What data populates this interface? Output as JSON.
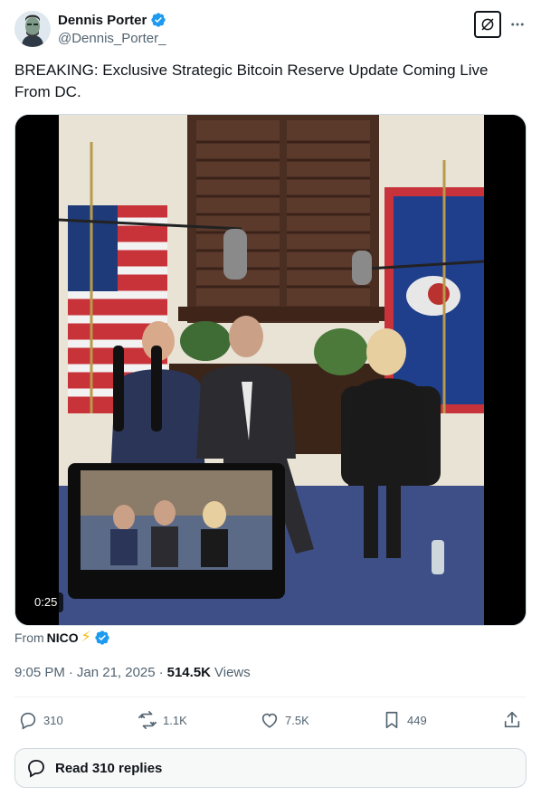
{
  "author": {
    "display_name": "Dennis Porter",
    "handle": "@Dennis_Porter_",
    "verified": true
  },
  "tweet": {
    "text": "BREAKING: Exclusive Strategic Bitcoin Reserve Update Coming Live From DC."
  },
  "media": {
    "duration": "0:25"
  },
  "source": {
    "label": "From",
    "name": "NICO",
    "emoji": "⚡"
  },
  "meta": {
    "time": "9:05 PM",
    "separator1": "·",
    "date": "Jan 21, 2025",
    "separator2": "·",
    "views_count": "514.5K",
    "views_label": "Views"
  },
  "actions": {
    "replies": "310",
    "reposts": "1.1K",
    "likes": "7.5K",
    "bookmarks": "449"
  },
  "read_replies": {
    "label": "Read 310 replies"
  },
  "colors": {
    "verified_blue": "#1d9bf0",
    "text_primary": "#0f1419",
    "text_secondary": "#536471"
  },
  "icons": [
    "avatar-image",
    "verified-badge-icon",
    "grok-icon",
    "more-icon",
    "reply-icon",
    "repost-icon",
    "like-icon",
    "bookmark-icon",
    "share-icon",
    "speech-bubble-icon"
  ]
}
